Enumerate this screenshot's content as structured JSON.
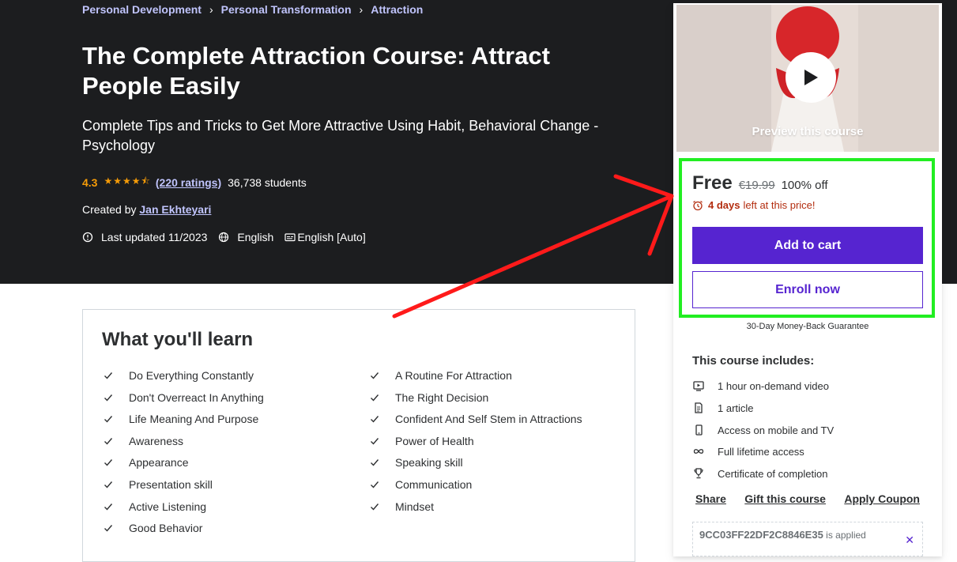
{
  "breadcrumb": {
    "items": [
      "Personal Development",
      "Personal Transformation",
      "Attraction"
    ]
  },
  "course": {
    "title": "The Complete Attraction Course: Attract People Easily",
    "subtitle": "Complete Tips and Tricks to Get More Attractive Using Habit, Behavioral Change - Psychology",
    "rating": "4.3",
    "rating_value": 4.3,
    "ratings_count": "(220 ratings)",
    "students": "36,738 students",
    "created_by_label": "Created by",
    "instructor": "Jan Ekhteyari",
    "last_updated": "Last updated 11/2023",
    "language": "English",
    "captions": "English [Auto]"
  },
  "learn": {
    "title": "What you'll learn",
    "left": [
      "Do Everything Constantly",
      "Don't Overreact In Anything",
      "Life Meaning And Purpose",
      "Awareness",
      "Appearance",
      "Presentation skill",
      "Active Listening",
      "Good Behavior"
    ],
    "right": [
      "A Routine For Attraction",
      "The Right Decision",
      "Confident And Self Stem in Attractions",
      "Power of Health",
      "Speaking skill",
      "Communication",
      "Mindset"
    ]
  },
  "sidebar": {
    "preview_label": "Preview this course",
    "price": "Free",
    "original_price": "€19.99",
    "discount": "100% off",
    "timer_bold": "4 days",
    "timer_rest": "left at this price!",
    "add_to_cart": "Add to cart",
    "enroll_now": "Enroll now",
    "guarantee": "30-Day Money-Back Guarantee",
    "includes_title": "This course includes:",
    "includes": [
      {
        "icon": "video-icon",
        "label": "1 hour on-demand video"
      },
      {
        "icon": "article-icon",
        "label": "1 article"
      },
      {
        "icon": "mobile-icon",
        "label": "Access on mobile and TV"
      },
      {
        "icon": "infinity-icon",
        "label": "Full lifetime access"
      },
      {
        "icon": "trophy-icon",
        "label": "Certificate of completion"
      }
    ],
    "share": "Share",
    "gift": "Gift this course",
    "apply_coupon": "Apply Coupon",
    "coupon_code": "9CC03FF22DF2C8846E35",
    "coupon_status": "is applied"
  },
  "colors": {
    "hero_bg": "#1c1d1f",
    "accent": "#5624d0",
    "link": "#c0c4fc",
    "star": "#f69c08",
    "timer": "#b32d0f",
    "highlight": "#22ee22",
    "annotation_arrow": "#ff1a1a"
  }
}
